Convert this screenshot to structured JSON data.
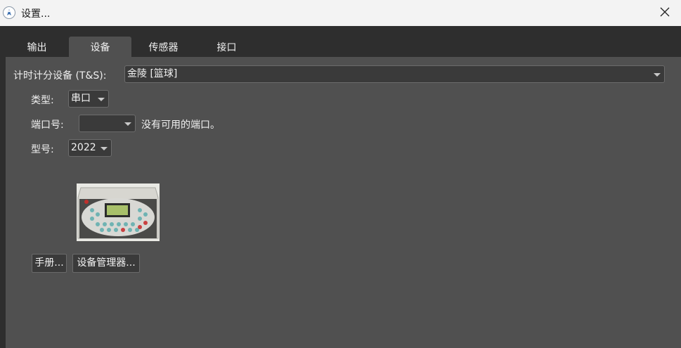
{
  "window": {
    "title": "设置..."
  },
  "tabs": [
    {
      "label": "输出"
    },
    {
      "label": "设备"
    },
    {
      "label": "传感器"
    },
    {
      "label": "接口"
    }
  ],
  "active_tab": "设备",
  "device": {
    "ts_label": "计时计分设备 (T&S):",
    "ts_value": "金陵 [篮球]",
    "type_label": "类型:",
    "type_value": "串口",
    "port_label": "端口号:",
    "port_value": "",
    "port_message": "没有可用的端口。",
    "model_label": "型号:",
    "model_value": "2022",
    "device_image_icon": "scoreboard-controller-photo"
  },
  "buttons": {
    "manual": "手册...",
    "device_manager": "设备管理器..."
  },
  "colors": {
    "titlebar_bg": "#f3f3f3",
    "window_bg": "#2e2e2e",
    "panel_bg": "#505050",
    "input_bg": "#3a3a3a"
  }
}
